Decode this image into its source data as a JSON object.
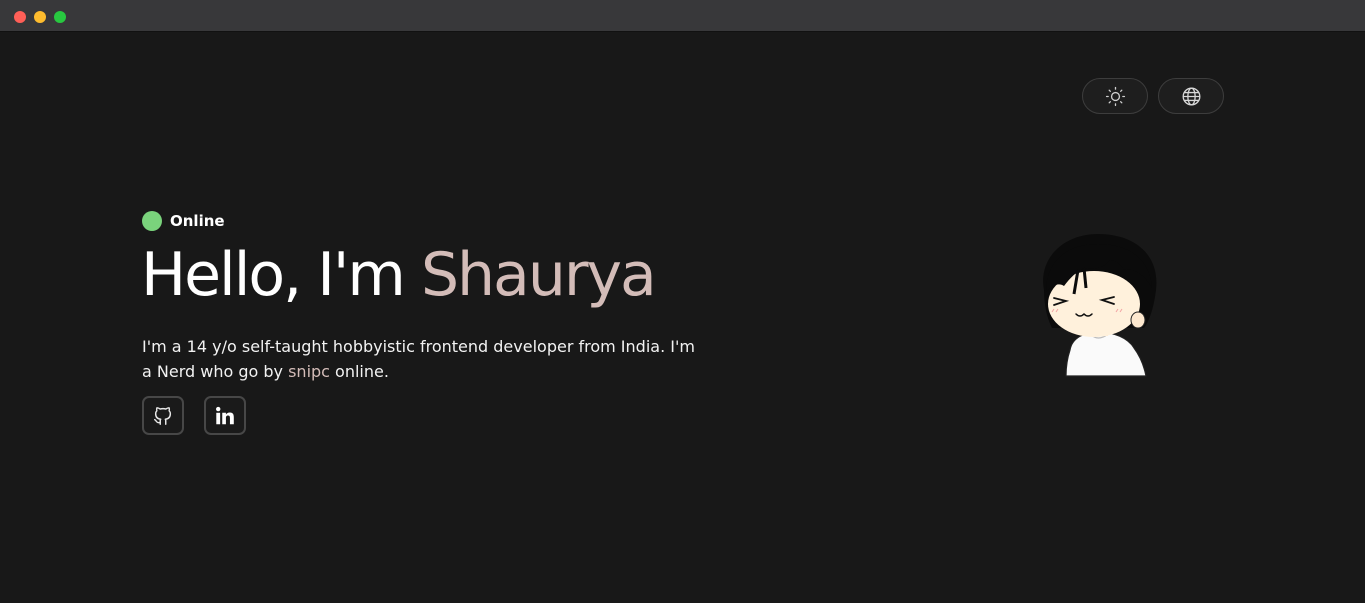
{
  "window": {
    "traffic_lights": [
      "close",
      "minimize",
      "zoom"
    ]
  },
  "toolbar": {
    "theme_icon": "sun-icon",
    "language_icon": "globe-icon"
  },
  "status": {
    "label": "Online",
    "color": "#7ad37c"
  },
  "hero": {
    "greeting": "Hello, I'm ",
    "name": "Shaurya",
    "name_color": "#d3bcb8"
  },
  "bio": {
    "before_handle": "I'm a 14 y/o self-taught hobbyistic frontend developer from India. I'm a Nerd who go by ",
    "handle": "snipc",
    "after_handle": " online."
  },
  "social": [
    {
      "name": "github",
      "icon": "github-icon"
    },
    {
      "name": "linkedin",
      "icon": "linkedin-icon"
    }
  ],
  "colors": {
    "background": "#181818",
    "accent": "#d3bcb8"
  }
}
